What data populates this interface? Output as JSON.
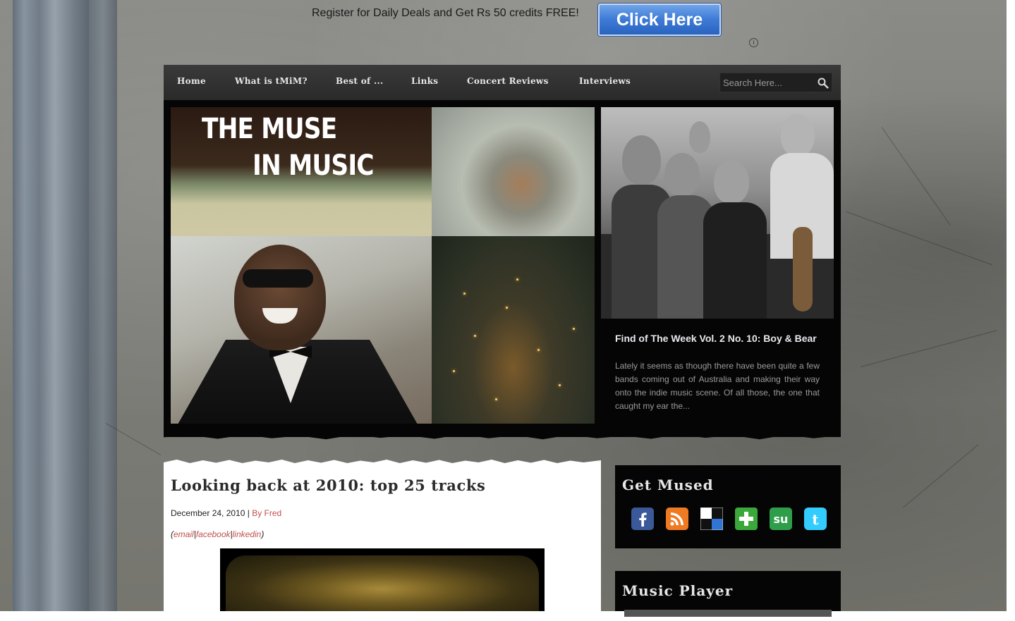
{
  "ad": {
    "text": "Register for Daily Deals and Get Rs 50 credits FREE!",
    "button_label": "Click Here",
    "info_glyph": "i"
  },
  "nav": {
    "items": [
      "Home",
      "What is tMiM?",
      "Best of ...",
      "Links",
      "Concert Reviews",
      "Interviews"
    ],
    "search_placeholder": "Search Here..."
  },
  "featured": {
    "banner_line1": "THE MUSE",
    "banner_line2": "IN MUSIC",
    "post_title": "Find of The Week Vol. 2 No. 10: Boy & Bear",
    "post_excerpt": "Lately it seems as though there have been quite a few bands coming out of Australia and making their way onto the indie music scene. Of all those, the one that caught my ear the..."
  },
  "post": {
    "title": "Looking back at 2010: top 25 tracks",
    "date": "December 24, 2010",
    "separator": " | ",
    "author": "By Fred",
    "share_open": "(",
    "share_email": "email",
    "share_sep": "|",
    "share_facebook": "facebook",
    "share_linkedin": "linkedin",
    "share_close": ")"
  },
  "sidebar": {
    "widget1_title": "Get Mused",
    "social_icons": [
      "facebook-icon",
      "rss-icon",
      "delicious-icon",
      "add-icon",
      "stumbleupon-icon",
      "twitter-icon"
    ],
    "widget2_title": "Music Player"
  },
  "colors": {
    "accent_link": "#c0504d",
    "nav_bg": "#2f2f2f",
    "ad_button": "#3d7ad6"
  }
}
